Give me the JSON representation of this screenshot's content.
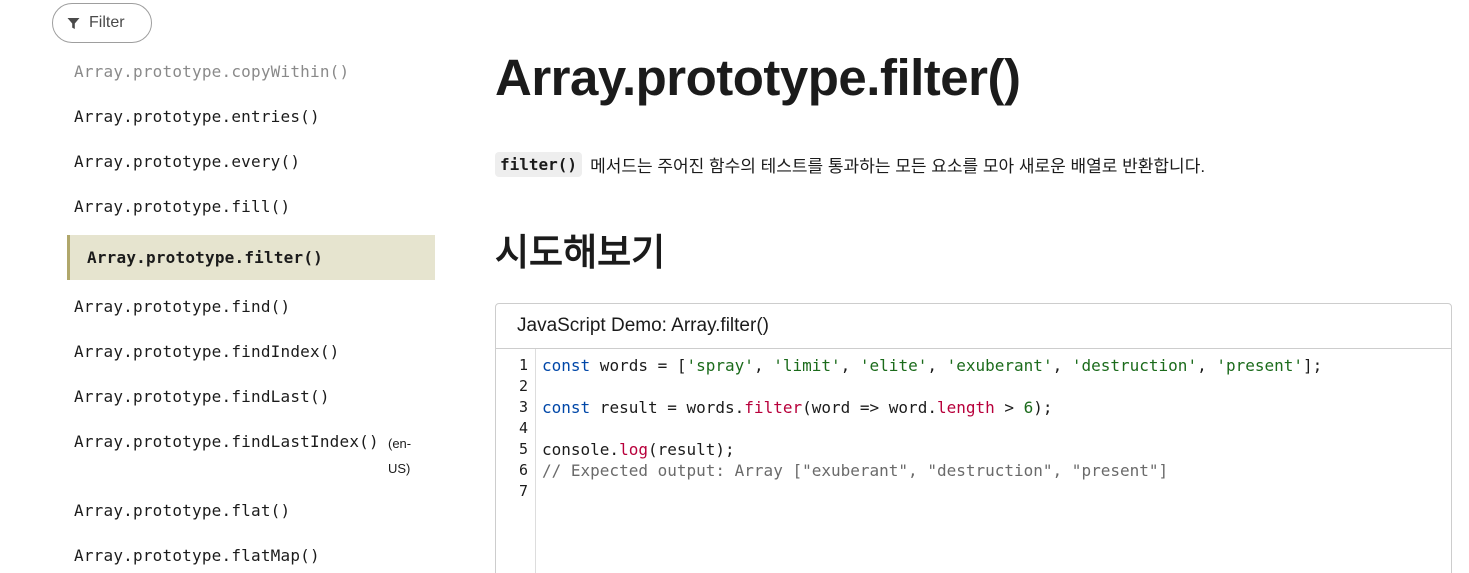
{
  "filter": {
    "label": "Filter"
  },
  "sidebar": {
    "items": [
      {
        "label": "Array.prototype.copyWithin()"
      },
      {
        "label": "Array.prototype.entries()"
      },
      {
        "label": "Array.prototype.every()"
      },
      {
        "label": "Array.prototype.fill()"
      },
      {
        "label": "Array.prototype.filter()"
      },
      {
        "label": "Array.prototype.find()"
      },
      {
        "label": "Array.prototype.findIndex()"
      },
      {
        "label": "Array.prototype.findLast()"
      },
      {
        "label": "Array.prototype.findLastIndex()"
      },
      {
        "label": "Array.prototype.flat()"
      },
      {
        "label": "Array.prototype.flatMap()"
      }
    ],
    "lang_tag_1": "(en-",
    "lang_tag_2": "US)"
  },
  "main": {
    "title": "Array.prototype.filter()",
    "desc_code": "filter()",
    "desc_text": "메서드는 주어진 함수의 테스트를 통과하는 모든 요소를 모아 새로운 배열로 반환합니다.",
    "section_title": "시도해보기"
  },
  "demo": {
    "header": "JavaScript Demo: Array.filter()",
    "line_numbers": [
      "1",
      "2",
      "3",
      "4",
      "5",
      "6",
      "7"
    ],
    "code": {
      "l1_kw": "const",
      "l1_a": " words = [",
      "l1_s1": "'spray'",
      "l1_c1": ", ",
      "l1_s2": "'limit'",
      "l1_c2": ", ",
      "l1_s3": "'elite'",
      "l1_c3": ", ",
      "l1_s4": "'exuberant'",
      "l1_c4": ", ",
      "l1_s5": "'destruction'",
      "l1_c5": ", ",
      "l1_s6": "'present'",
      "l1_end": "];",
      "l3_kw": "const",
      "l3_a": " result = words.",
      "l3_fn": "filter",
      "l3_b": "(word => word.",
      "l3_prop": "length",
      "l3_c": " > ",
      "l3_num": "6",
      "l3_end": ");",
      "l5_a": "console.",
      "l5_fn": "log",
      "l5_b": "(result);",
      "l6_comment": "// Expected output: Array [\"exuberant\", \"destruction\", \"present\"]"
    }
  }
}
